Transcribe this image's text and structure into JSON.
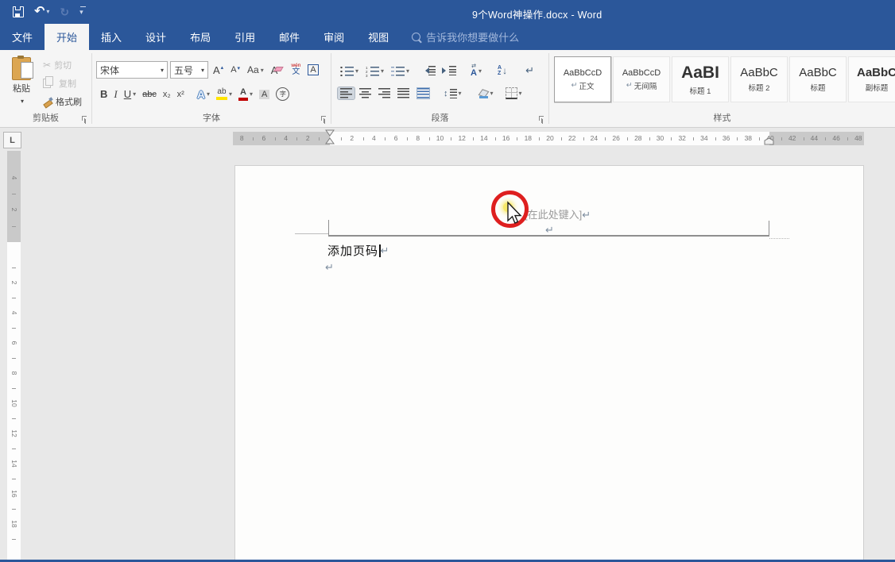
{
  "titlebar": {
    "title": "9个Word神操作.docx - Word"
  },
  "qat": {
    "save": "保存",
    "undo": "撤消",
    "redo": "恢复",
    "customize": "自定义快速访问工具栏"
  },
  "tabs": {
    "file": "文件",
    "items": [
      "开始",
      "插入",
      "设计",
      "布局",
      "引用",
      "邮件",
      "审阅",
      "视图"
    ],
    "active": "开始",
    "search": "告诉我你想要做什么"
  },
  "ribbon": {
    "clipboard": {
      "label": "剪贴板",
      "paste": "粘贴",
      "cut": "剪切",
      "copy": "复制",
      "format_painter": "格式刷"
    },
    "font": {
      "label": "字体",
      "font_name": "宋体",
      "font_size": "五号",
      "grow": "A",
      "shrink": "A",
      "case": "Aa",
      "clear": "A",
      "pinyin_top": "wén",
      "pinyin_bottom": "文",
      "char_border": "A",
      "bold": "B",
      "italic": "I",
      "underline": "U",
      "strike": "abc",
      "subscript": "x₂",
      "superscript": "x²",
      "effects": "A",
      "highlight": "ab",
      "font_color": "A",
      "char_shading": "A",
      "circle_char": "字"
    },
    "paragraph": {
      "label": "段落",
      "cjk_layout": "A",
      "sort_top": "A",
      "sort_bottom": "Z"
    },
    "styles": {
      "label": "样式",
      "items": [
        {
          "sample": "AaBbCcD",
          "name": "正文",
          "pilcrow": "↵"
        },
        {
          "sample": "AaBbCcD",
          "name": "无间隔",
          "pilcrow": "↵"
        },
        {
          "sample": "AaBI",
          "name": "标题 1"
        },
        {
          "sample": "AaBbC",
          "name": "标题 2"
        },
        {
          "sample": "AaBbC",
          "name": "标题"
        },
        {
          "sample": "AaBbC",
          "name": "副标题"
        }
      ]
    }
  },
  "ruler": {
    "tab_selector": "L",
    "h_left_margin": [
      8,
      6,
      4,
      2
    ],
    "h_active": [
      2,
      4,
      6,
      8,
      10,
      12,
      14,
      16,
      18,
      20,
      22,
      24,
      26,
      28,
      30,
      32,
      34,
      36,
      38
    ],
    "h_right_margin": [
      40,
      42,
      44,
      46,
      48
    ],
    "v_margin": [
      4,
      2
    ],
    "v_active": [
      2,
      4,
      6,
      8,
      10,
      12,
      14,
      16,
      18
    ]
  },
  "document": {
    "header_placeholder": "[在此处键入]",
    "pilcrow": "↵",
    "body_text": "添加页码"
  },
  "colors": {
    "accent": "#2b579a",
    "annotation_red": "#de1f1f",
    "highlight_yellow": "#ffe400",
    "font_color_red": "#c00000"
  }
}
